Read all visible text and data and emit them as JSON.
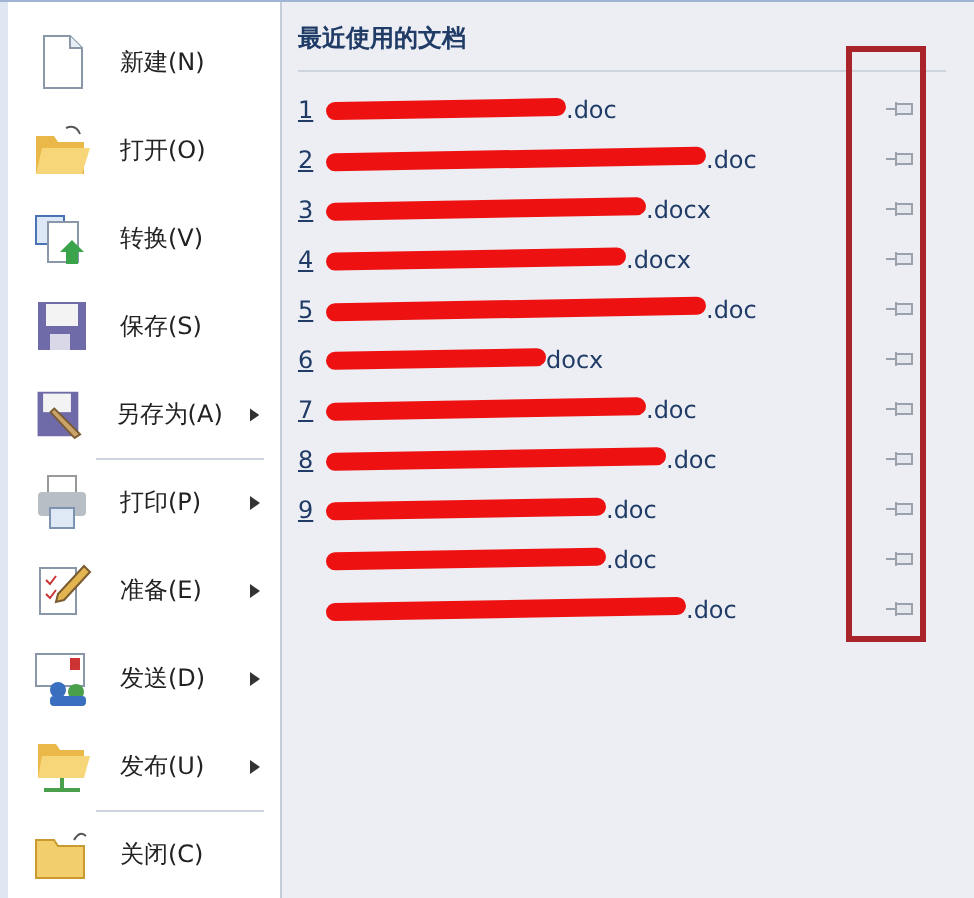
{
  "menu": [
    {
      "label": "新建(N)",
      "submenu": false,
      "divider_before": false
    },
    {
      "label": "打开(O)",
      "submenu": false,
      "divider_before": false
    },
    {
      "label": "转换(V)",
      "submenu": false,
      "divider_before": false
    },
    {
      "label": "保存(S)",
      "submenu": false,
      "divider_before": false
    },
    {
      "label": "另存为(A)",
      "submenu": true,
      "divider_before": false
    },
    {
      "label": "打印(P)",
      "submenu": true,
      "divider_before": true
    },
    {
      "label": "准备(E)",
      "submenu": true,
      "divider_before": false
    },
    {
      "label": "发送(D)",
      "submenu": true,
      "divider_before": false
    },
    {
      "label": "发布(U)",
      "submenu": true,
      "divider_before": false
    },
    {
      "label": "关闭(C)",
      "submenu": false,
      "divider_before": true
    }
  ],
  "recent": {
    "title": "最近使用的文档",
    "documents": [
      {
        "number": "1",
        "name": ".doc"
      },
      {
        "number": "2",
        "name": ".doc"
      },
      {
        "number": "3",
        "name": ".docx"
      },
      {
        "number": "4",
        "name": ".docx"
      },
      {
        "number": "5",
        "name": ".doc"
      },
      {
        "number": "6",
        "name": "docx"
      },
      {
        "number": "7",
        "name": ".doc"
      },
      {
        "number": "8",
        "name": ".doc"
      },
      {
        "number": "9",
        "name": ".doc"
      },
      {
        "name": ".doc"
      },
      {
        "name": ".doc"
      }
    ]
  }
}
